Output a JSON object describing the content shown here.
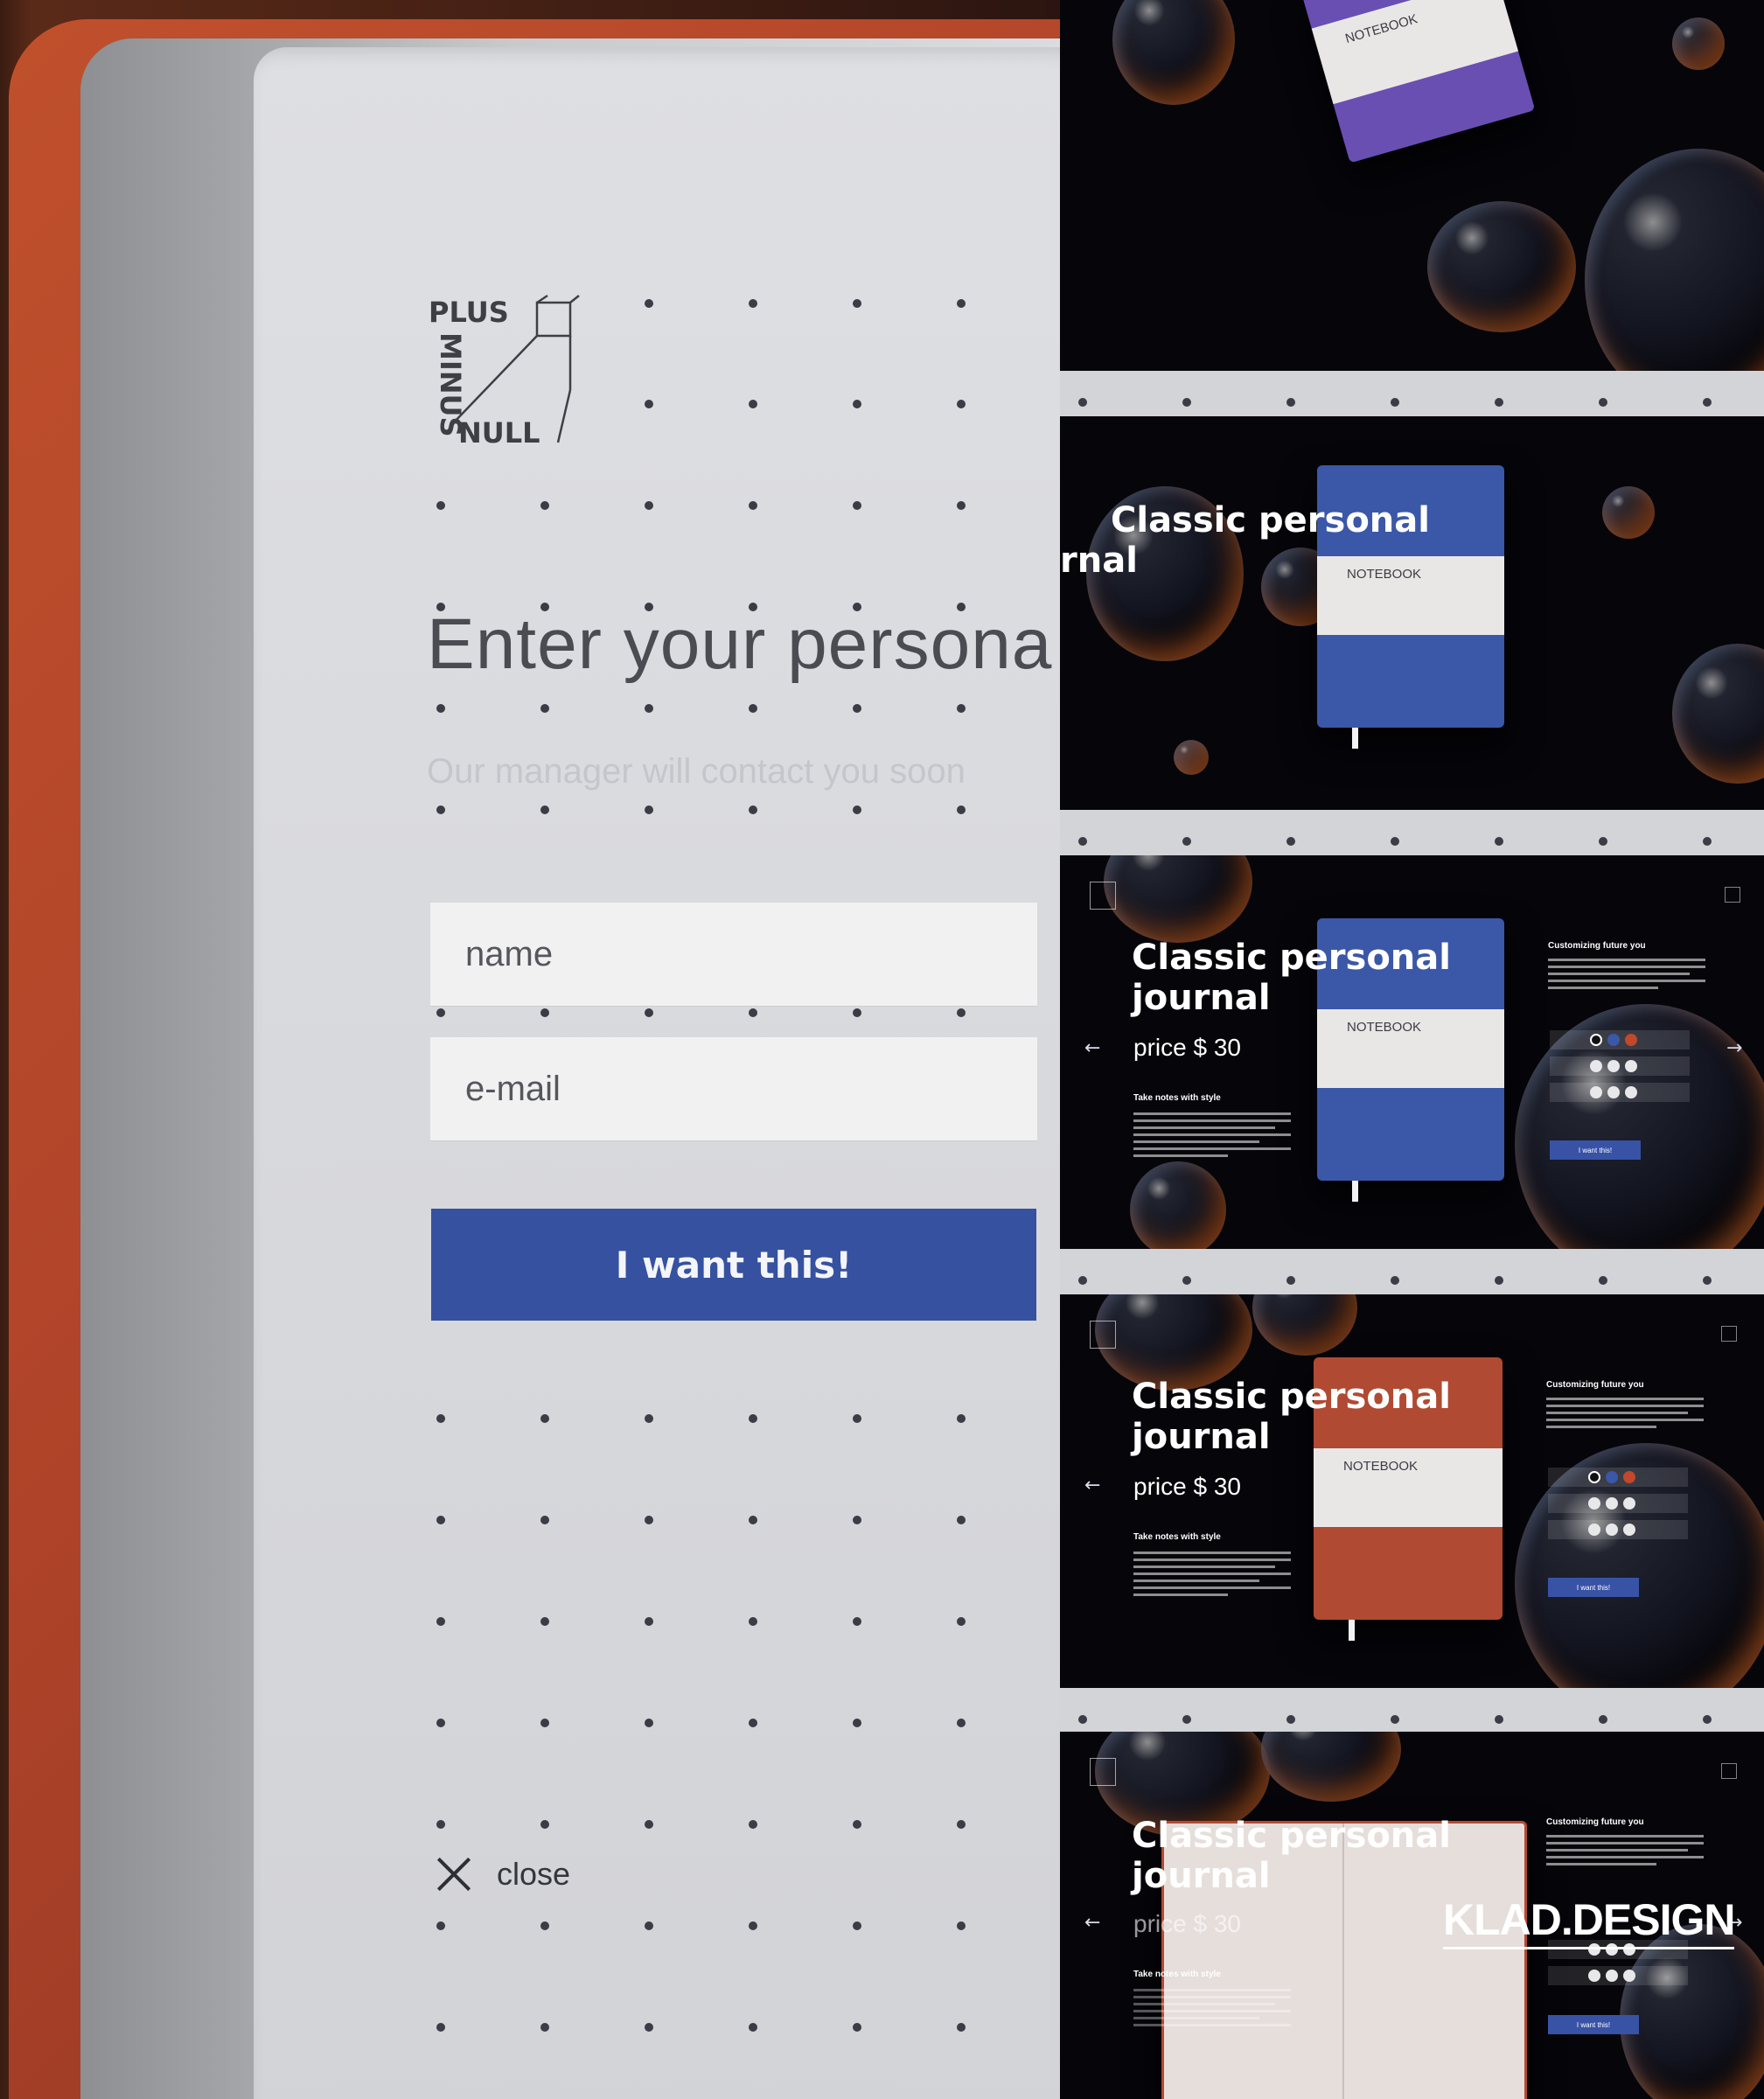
{
  "logo": {
    "line_top": "PLUS",
    "line_side": "MINUS",
    "line_bottom": "NULL"
  },
  "form": {
    "heading": "Enter your persona",
    "subheading": "Our manager will contact you soon",
    "name_placeholder": "name",
    "email_placeholder": "e-mail",
    "submit_label": "I want this!",
    "close_label": "close"
  },
  "colors": {
    "accent": "#3651a0",
    "page": "#dcdde1",
    "cover": "#b54a2b"
  },
  "cards": [
    {
      "book_label": "NOTEBOOK"
    },
    {
      "title_partial_1": "Classic personal",
      "title_partial_2": "rnal",
      "book_label": "NOTEBOOK"
    },
    {
      "title_1": "Classic personal",
      "title_2": "journal",
      "price": "price $ 30",
      "section_left": "Take notes with style",
      "section_right": "Customizing future you",
      "book_label": "NOTEBOOK",
      "button": "I want this!"
    },
    {
      "title_1": "Classic personal",
      "title_2": "journal",
      "price": "price $ 30",
      "section_left": "Take notes with style",
      "section_right": "Customizing future you",
      "book_label": "NOTEBOOK",
      "button": "I want this!"
    },
    {
      "title_1": "Classic personal",
      "title_2": "journal",
      "price": "price $ 30",
      "section_left": "Take notes with style",
      "section_right": "Customizing future you",
      "button": "I want this!"
    }
  ],
  "watermark": "KLAD.DESIGN"
}
